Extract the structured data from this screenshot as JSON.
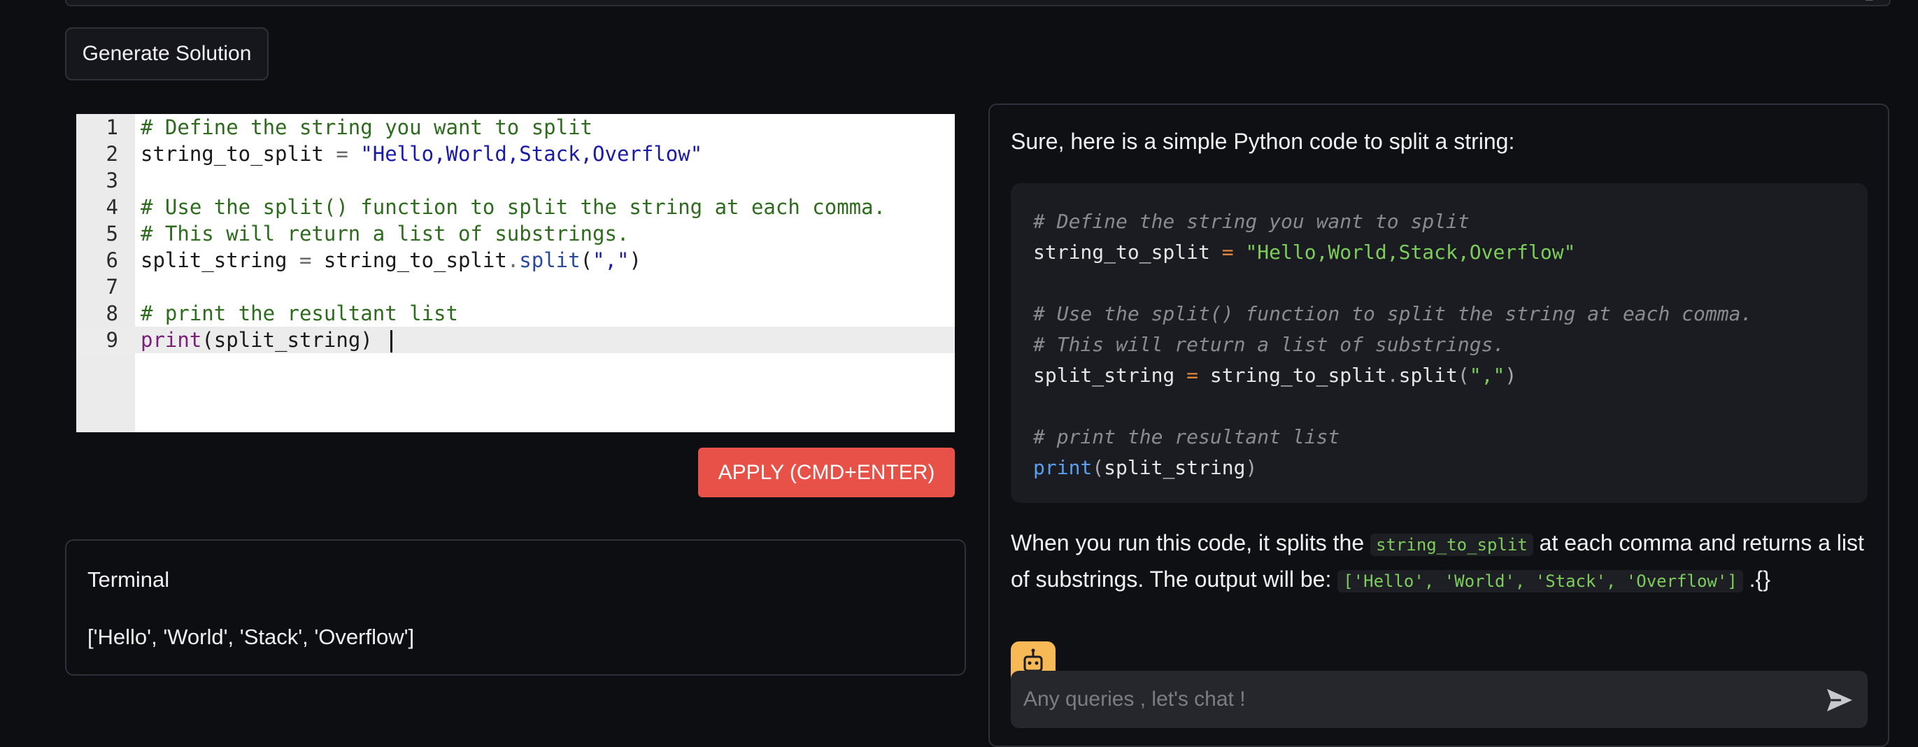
{
  "toolbar": {
    "generate_label": "Generate Solution"
  },
  "editor": {
    "lines": [
      {
        "num": "1",
        "text": "# Define the string you want to split"
      },
      {
        "num": "2",
        "text": "string_to_split = \"Hello,World,Stack,Overflow\""
      },
      {
        "num": "3",
        "text": ""
      },
      {
        "num": "4",
        "text": "# Use the split() function to split the string at each comma."
      },
      {
        "num": "5",
        "text": "# This will return a list of substrings."
      },
      {
        "num": "6",
        "text": "split_string = string_to_split.split(\",\")"
      },
      {
        "num": "7",
        "text": ""
      },
      {
        "num": "8",
        "text": "# print the resultant list"
      },
      {
        "num": "9",
        "text": "print(split_string) "
      }
    ],
    "active_line": 9,
    "apply_label": "APPLY (CMD+ENTER)"
  },
  "terminal": {
    "title": "Terminal",
    "output": "['Hello', 'World', 'Stack', 'Overflow']"
  },
  "chat": {
    "intro": "Sure, here is a simple Python code to split a string:",
    "code_lines": [
      "# Define the string you want to split",
      "string_to_split = \"Hello,World,Stack,Overflow\"",
      "",
      "# Use the split() function to split the string at each comma.",
      "# This will return a list of substrings.",
      "split_string = string_to_split.split(\",\")",
      "",
      "# print the resultant list",
      "print(split_string)"
    ],
    "explanation": {
      "part1": "When you run this code, it splits the ",
      "code1": "string_to_split",
      "part2": " at each comma and returns a list of substrings. The output will be: ",
      "code2": "['Hello', 'World', 'Stack', 'Overflow']",
      "part3": " .{}"
    },
    "input_placeholder": "Any queries , let's chat !",
    "bot_icon": "robot-icon",
    "send_icon": "send-icon"
  },
  "colors": {
    "background": "#0d0e12",
    "apply_button": "#e85148",
    "avatar": "#f7b955",
    "code_string_green": "#7ccd5a",
    "code_fn_blue": "#5aa0f0",
    "code_op_orange": "#e0873a"
  }
}
